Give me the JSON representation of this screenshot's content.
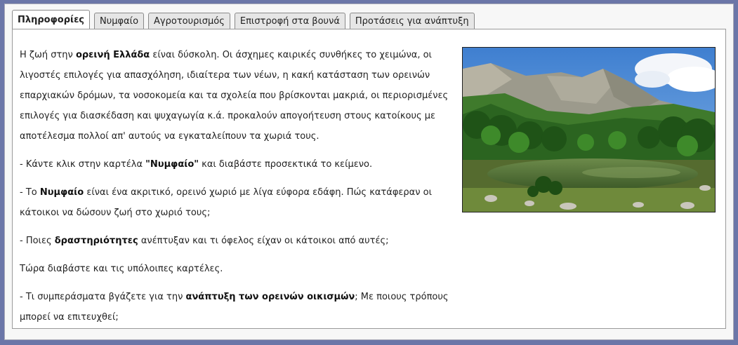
{
  "tabs": [
    {
      "label": "Πληροφορίες",
      "active": true
    },
    {
      "label": "Νυμφαίο",
      "active": false
    },
    {
      "label": "Αγροτουρισμός",
      "active": false
    },
    {
      "label": "Επιστροφή στα βουνά",
      "active": false
    },
    {
      "label": "Προτάσεις για ανάπτυξη",
      "active": false
    }
  ],
  "content": {
    "p1": {
      "a": "Η ζωή στην ",
      "b_bold": "ορεινή Ελλάδα",
      "c": " είναι δύσκολη. Οι άσχημες καιρικές συνθήκες το χειμώνα, οι λιγοστές επιλογές για απασχόληση, ιδιαίτερα των νέων, η κακή κατάσταση των ορεινών επαρχιακών δρόμων, τα νοσοκομεία και τα σχολεία που βρίσκονται μακριά, οι περιορισμένες επιλογές για διασκέδαση και ψυχαγωγία κ.ά. προκαλούν απογοήτευση στους κατοίκους με αποτέλεσμα πολλοί απ' αυτούς να εγκαταλείπουν τα χωριά τους."
    },
    "p2": {
      "a": "- Κάντε κλικ στην καρτέλα ",
      "b_bold": "\"Νυμφαίο\"",
      "c": " και διαβάστε προσεκτικά το κείμενο."
    },
    "p3": {
      "a": "- Το ",
      "b_bold": "Νυμφαίο",
      "c": " είναι ένα ακριτικό, ορεινό χωριό με λίγα εύφορα εδάφη. Πώς κατάφεραν οι κάτοικοι να δώσουν ζωή στο χωριό τους;"
    },
    "p4": {
      "a": "- Ποιες ",
      "b_bold": "δραστηριότητες",
      "c": " ανέπτυξαν και τι όφελος είχαν οι κάτοικοι από αυτές;"
    },
    "p5": {
      "a": "Τώρα διαβάστε και τις υπόλοιπες καρτέλες."
    },
    "p6": {
      "a": "- Τι συμπεράσματα βγάζετε για την ",
      "b_bold": "ανάπτυξη των ορεινών οικισμών",
      "c": "; Με ποιους τρόπους μπορεί να επιτευχθεί;"
    }
  },
  "image": {
    "name": "mountain-lake-photo",
    "colors": {
      "sky": "#4f8fd6",
      "forest": "#2f6a25",
      "lake": "#5a7a3a"
    }
  }
}
